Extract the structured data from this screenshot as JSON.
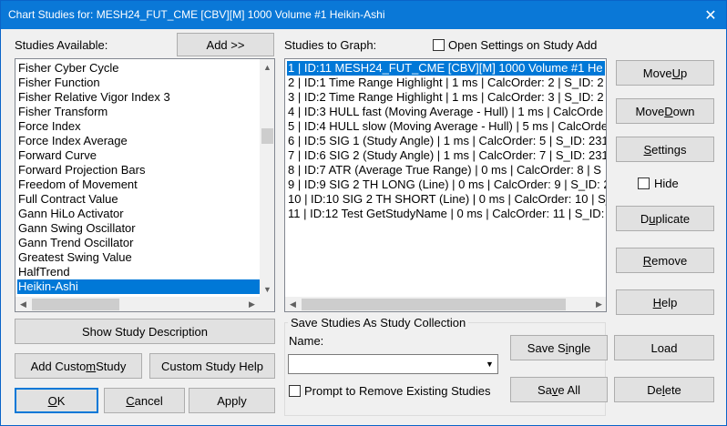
{
  "window": {
    "title": "Chart Studies for: MESH24_FUT_CME [CBV][M]  1000 Volume #1 Heikin-Ashi",
    "close_glyph": "✕"
  },
  "studies_available": {
    "label": "Studies Available:",
    "add_button": "Add >>",
    "items": [
      "Fisher Cyber Cycle",
      "Fisher Function",
      "Fisher Relative Vigor Index 3",
      "Fisher Transform",
      "Force Index",
      "Force Index Average",
      "Forward Curve",
      "Forward Projection Bars",
      "Freedom of Movement",
      "Full Contract Value",
      "Gann HiLo Activator",
      "Gann Swing Oscillator",
      "Gann Trend Oscillator",
      "Greatest Swing Value",
      "HalfTrend",
      "Heikin-Ashi"
    ],
    "selected_index": 15
  },
  "studies_to_graph": {
    "label": "Studies to Graph:",
    "open_settings_label": "Open Settings on Study Add",
    "items": [
      "1 | ID:11  MESH24_FUT_CME [CBV][M]  1000 Volume #1 He",
      "2 | ID:1  Time Range Highlight | 1 ms | CalcOrder: 2 | S_ID: 2",
      "3 | ID:2  Time Range Highlight | 1 ms | CalcOrder: 3 | S_ID: 2",
      "4 | ID:3  HULL fast (Moving Average - Hull) | 1 ms | CalcOrde",
      "5 | ID:4  HULL slow (Moving Average - Hull) | 5 ms | CalcOrde",
      "6 | ID:5  SIG 1 (Study Angle) | 1 ms | CalcOrder: 5 | S_ID: 231",
      "7 | ID:6  SIG 2 (Study Angle) | 1 ms | CalcOrder: 7 | S_ID: 231",
      "8 | ID:7  ATR (Average True Range) | 0 ms | CalcOrder: 8 | S",
      "9 | ID:9  SIG 2 TH LONG (Line) | 0 ms | CalcOrder: 9 | S_ID: 2",
      "10 | ID:10  SIG 2 TH SHORT (Line) | 0 ms | CalcOrder: 10 | S_",
      "11 | ID:12  Test GetStudyName | 0 ms | CalcOrder: 11 | S_ID:"
    ],
    "selected_index": 0
  },
  "right_buttons": {
    "move_up": [
      "Move ",
      "U",
      "p"
    ],
    "move_down": [
      "Move ",
      "D",
      "own"
    ],
    "settings": [
      "",
      "S",
      "ettings"
    ],
    "hide_label": "Hide",
    "duplicate": [
      "D",
      "u",
      "plicate"
    ],
    "remove": [
      "",
      "R",
      "emove"
    ],
    "help": [
      "",
      "H",
      "elp"
    ]
  },
  "bottom_left": {
    "show_description": "Show Study Description",
    "add_custom": [
      "Add Custo",
      "m",
      " Study"
    ],
    "custom_help": "Custom Study Help",
    "ok": [
      "",
      "O",
      "K"
    ],
    "cancel": [
      "",
      "C",
      "ancel"
    ],
    "apply": "Apply"
  },
  "collection": {
    "group_title": "Save Studies As Study Collection",
    "name_label": "Name:",
    "name_value": "",
    "prompt_label": "Prompt to Remove Existing Studies",
    "save_single": [
      "Save S",
      "i",
      "ngle"
    ],
    "save_all": [
      "Sa",
      "v",
      "e All"
    ],
    "load": "Load",
    "delete": [
      "De",
      "l",
      "ete"
    ]
  }
}
